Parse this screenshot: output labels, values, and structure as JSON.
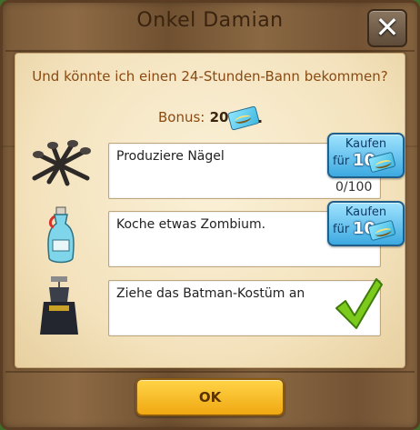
{
  "dialog": {
    "title": "Onkel Damian",
    "question": "Und könnte ich einen 24-Stunden-Bann bekommen?",
    "bonus_label": "Bonus:",
    "bonus_value": "20",
    "bonus_suffix": ".",
    "ok_label": "OK"
  },
  "tasks": [
    {
      "icon": "nails-icon",
      "text": "Produziere Nägel",
      "progress": "0/100",
      "buy_label": "Kaufen",
      "buy_for": "für",
      "buy_cost": "10",
      "completed": false
    },
    {
      "icon": "potion-bottle-icon",
      "text": "Koche etwas Zombium.",
      "buy_label": "Kaufen",
      "buy_for": "für",
      "buy_cost": "10",
      "completed": false
    },
    {
      "icon": "batman-costume-icon",
      "text": "Ziehe das Batman-Kostüm an",
      "completed": true
    }
  ],
  "colors": {
    "accent": "#8a4a12",
    "buy_button": "#3da9e0",
    "ok_button": "#f0a812",
    "check": "#7ccb1c"
  }
}
